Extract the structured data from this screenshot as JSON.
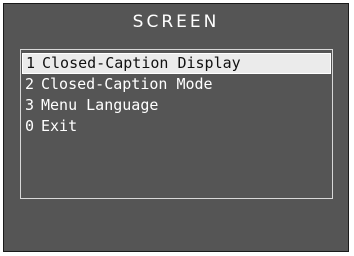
{
  "title": "SCREEN",
  "menu": {
    "items": [
      {
        "number": "1",
        "label": "Closed-Caption Display",
        "selected": true
      },
      {
        "number": "2",
        "label": "Closed-Caption Mode",
        "selected": false
      },
      {
        "number": "3",
        "label": "Menu Language",
        "selected": false
      },
      {
        "number": "0",
        "label": "Exit",
        "selected": false
      }
    ]
  },
  "colors": {
    "background": "#555555",
    "text": "#ffffff",
    "highlight_background": "#ebebeb",
    "highlight_text": "#111111",
    "panel_border": "#d8d8d8"
  }
}
